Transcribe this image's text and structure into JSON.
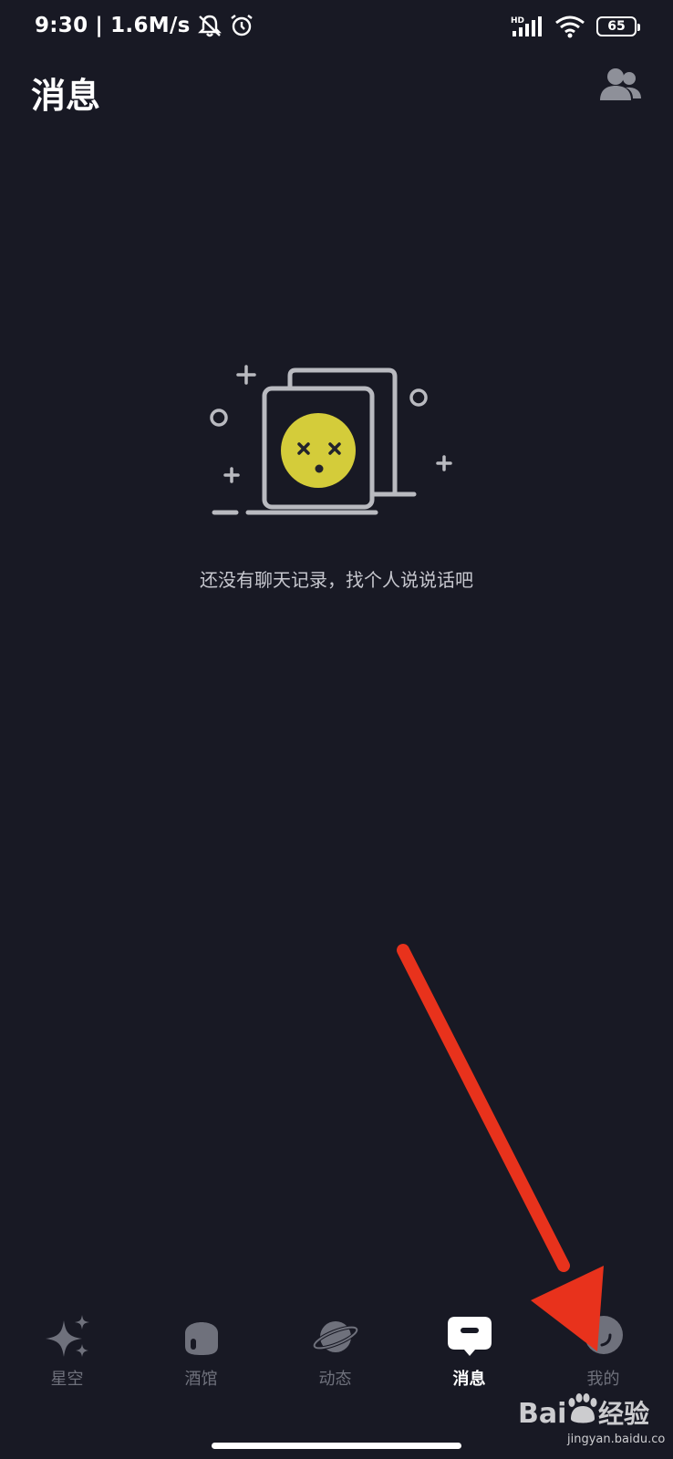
{
  "status_bar": {
    "time": "9:30",
    "separator": "|",
    "network_speed": "1.6M/s",
    "icons": [
      "mute-icon",
      "alarm-icon",
      "hd-signal-icon",
      "wifi-icon"
    ],
    "battery": "65"
  },
  "header": {
    "title": "消息",
    "contacts_icon": "contacts-icon"
  },
  "empty_state": {
    "message": "还没有聊天记录，找个人说说话吧",
    "accent_color": "#d4cc3a"
  },
  "tab_bar": {
    "tabs": [
      {
        "label": "星空",
        "icon": "sparkle-icon",
        "active": false
      },
      {
        "label": "酒馆",
        "icon": "tavern-icon",
        "active": false
      },
      {
        "label": "动态",
        "icon": "planet-icon",
        "active": false
      },
      {
        "label": "消息",
        "icon": "chat-bubble-icon",
        "active": true
      },
      {
        "label": "我的",
        "icon": "profile-icon",
        "active": false
      }
    ]
  },
  "colors": {
    "background": "#181924",
    "inactive_tab": "#6f717c",
    "annotation_arrow": "#e8321c"
  },
  "watermark": {
    "brand": "Bai du 经验",
    "url": "jingyan.baidu.com"
  }
}
